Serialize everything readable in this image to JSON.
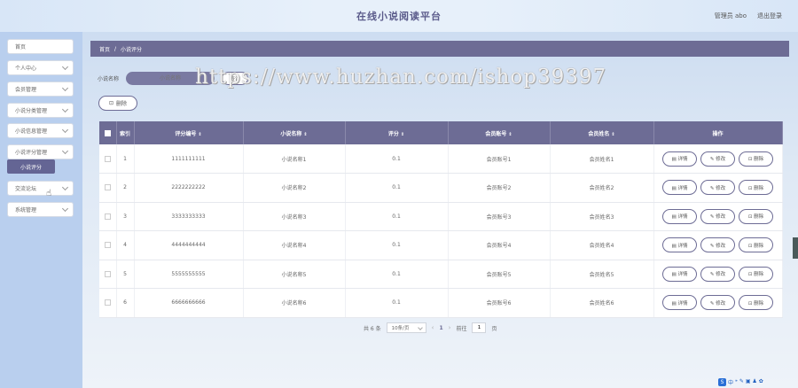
{
  "header": {
    "title": "在线小说阅读平台",
    "user_role": "管理员 abo",
    "logout": "退出登录"
  },
  "sidebar": {
    "items": [
      {
        "label": "首页",
        "has_chevron": false
      },
      {
        "label": "个人中心",
        "has_chevron": true
      },
      {
        "label": "会员管理",
        "has_chevron": true
      },
      {
        "label": "小说分类管理",
        "has_chevron": true
      },
      {
        "label": "小说信息管理",
        "has_chevron": true
      },
      {
        "label": "小说评分管理",
        "has_chevron": true
      },
      {
        "label": "交流论坛",
        "has_chevron": true
      },
      {
        "label": "系统管理",
        "has_chevron": true
      }
    ],
    "active_sub": "小说评分"
  },
  "breadcrumb": {
    "home": "首页",
    "separator": "/",
    "current": "小说评分"
  },
  "search": {
    "label": "小说名称",
    "placeholder": "小说名称",
    "button": "查询"
  },
  "watermark": "https://www.huzhan.com/ishop39397",
  "delete_button": "删除",
  "table": {
    "headers": [
      "索引",
      "评分编号",
      "小说名称",
      "评分",
      "会员账号",
      "会员姓名",
      "操作"
    ],
    "sortable": [
      false,
      true,
      true,
      true,
      true,
      true,
      false
    ],
    "rows": [
      {
        "index": "1",
        "code": "1111111111",
        "novel": "小说名称1",
        "score": "0.1",
        "account": "会员账号1",
        "name": "会员姓名1"
      },
      {
        "index": "2",
        "code": "2222222222",
        "novel": "小说名称2",
        "score": "0.1",
        "account": "会员账号2",
        "name": "会员姓名2"
      },
      {
        "index": "3",
        "code": "3333333333",
        "novel": "小说名称3",
        "score": "0.1",
        "account": "会员账号3",
        "name": "会员姓名3"
      },
      {
        "index": "4",
        "code": "4444444444",
        "novel": "小说名称4",
        "score": "0.1",
        "account": "会员账号4",
        "name": "会员姓名4"
      },
      {
        "index": "5",
        "code": "5555555555",
        "novel": "小说名称5",
        "score": "0.1",
        "account": "会员账号5",
        "name": "会员姓名5"
      },
      {
        "index": "6",
        "code": "6666666666",
        "novel": "小说名称6",
        "score": "0.1",
        "account": "会员账号6",
        "name": "会员姓名6"
      }
    ],
    "actions": {
      "detail": "详情",
      "edit": "修改",
      "delete": "删除"
    }
  },
  "pagination": {
    "total": "共 6 条",
    "page_size": "10条/页",
    "current_page": "1",
    "goto_label": "前往",
    "goto_value": "1",
    "page_unit": "页"
  },
  "ime": {
    "badge": "S",
    "label": "中"
  },
  "colors": {
    "primary": "#6d6c95",
    "sidebar": "#b9cfee"
  }
}
